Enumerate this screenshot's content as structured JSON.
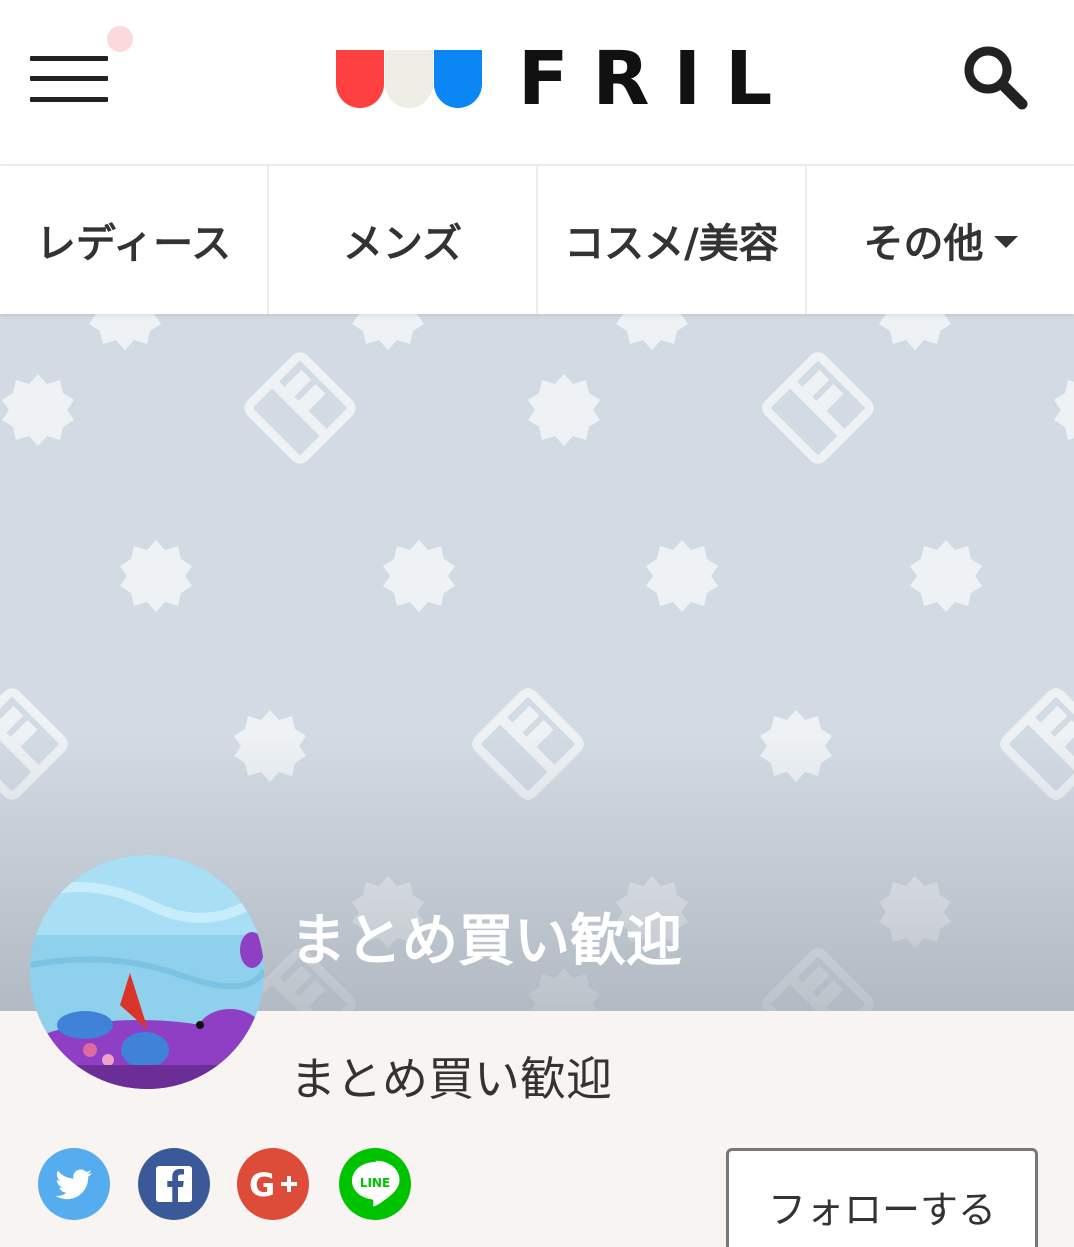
{
  "header": {
    "logo_text": "FRIL",
    "logo_colors": [
      "#ff4040",
      "#eeeee6",
      "#0a86f5"
    ]
  },
  "tabs": [
    {
      "label": "レディース"
    },
    {
      "label": "メンズ"
    },
    {
      "label": "コスメ/美容"
    },
    {
      "label": "その他"
    }
  ],
  "shop": {
    "title": "まとめ買い歓迎",
    "subtitle": "まとめ買い歓迎"
  },
  "social": {
    "twitter_color": "#55acee",
    "facebook_color": "#3b5998",
    "googleplus_color": "#dd4b39",
    "line_color": "#00c300",
    "line_label": "LINE"
  },
  "follow": {
    "label": "フォローする"
  },
  "colors": {
    "cover_bg": "#d2dbe3",
    "profile_bg": "#f7f4f2"
  }
}
